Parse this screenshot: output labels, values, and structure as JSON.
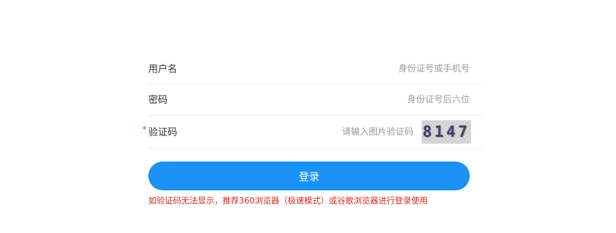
{
  "form": {
    "username": {
      "label": "用户名",
      "placeholder": "身份证号或手机号",
      "value": ""
    },
    "password": {
      "label": "密码",
      "placeholder": "身份证号后六位",
      "value": ""
    },
    "captcha": {
      "required_mark": "*",
      "label": "验证码",
      "placeholder": "请输入图片验证码",
      "value": "",
      "image_text": "8147"
    },
    "login_label": "登录",
    "notice": "如验证码无法显示，推荐360浏览器（极速模式）或谷歌浏览器进行登录使用"
  },
  "colors": {
    "accent": "#1b92f6",
    "warning": "#d8281f"
  }
}
